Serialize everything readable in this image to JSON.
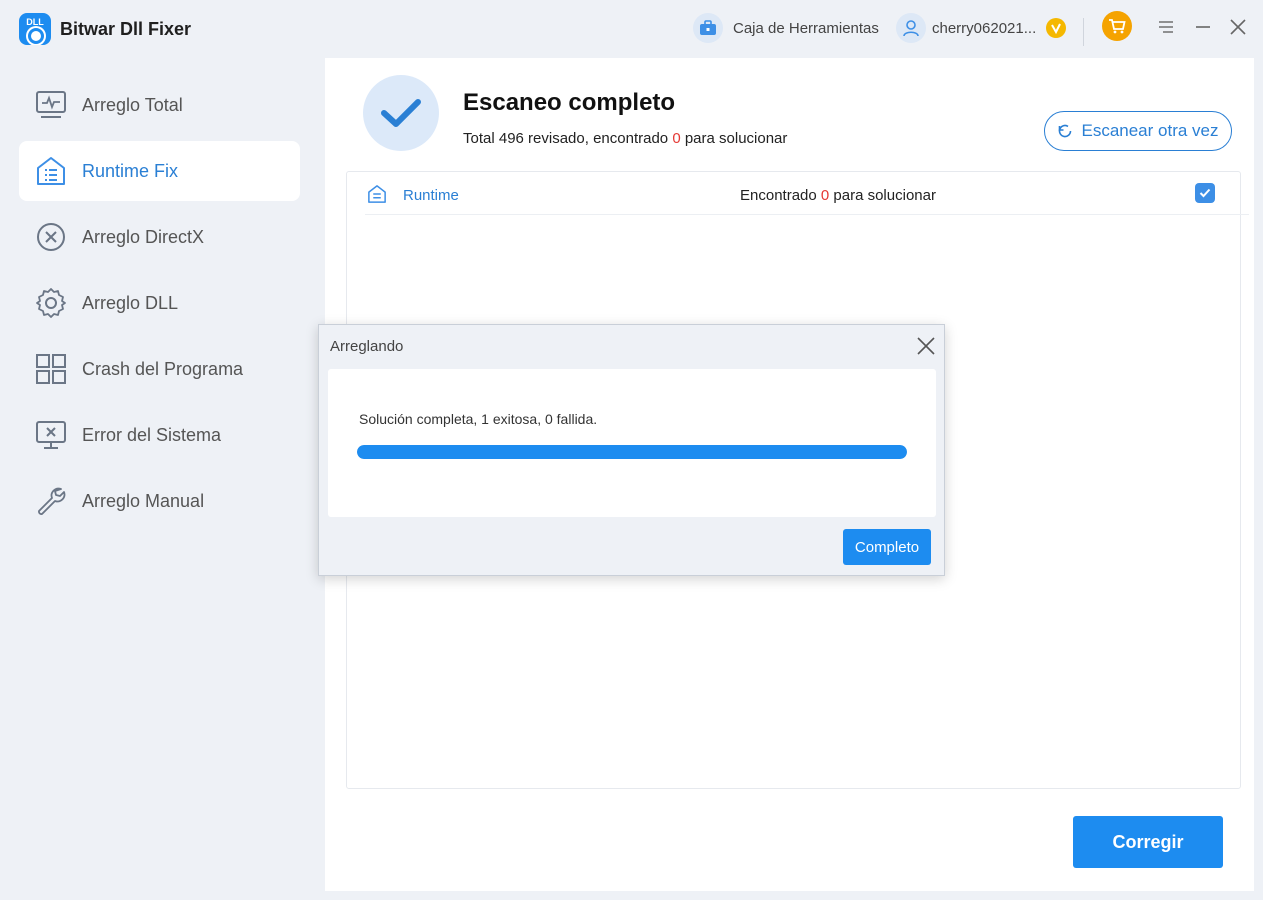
{
  "app": {
    "title": "Bitwar Dll Fixer",
    "logo_text": "DLL"
  },
  "topbar": {
    "toolbox_label": "Caja de Herramientas",
    "username": "cherry062021...",
    "icons": [
      "toolbox-icon",
      "user-icon",
      "vip-badge-icon",
      "cart-icon",
      "menu-icon",
      "minimize-icon",
      "close-icon"
    ]
  },
  "sidebar": {
    "items": [
      {
        "label": "Arreglo Total",
        "icon": "monitor-pulse-icon",
        "active": false
      },
      {
        "label": "Runtime Fix",
        "icon": "runtime-icon",
        "active": true
      },
      {
        "label": "Arreglo DirectX",
        "icon": "x-circle-icon",
        "active": false
      },
      {
        "label": "Arreglo DLL",
        "icon": "gear-icon",
        "active": false
      },
      {
        "label": "Crash del Programa",
        "icon": "grid-icon",
        "active": false
      },
      {
        "label": "Error del Sistema",
        "icon": "monitor-x-icon",
        "active": false
      },
      {
        "label": "Arreglo Manual",
        "icon": "wrench-icon",
        "active": false
      }
    ]
  },
  "main": {
    "scan_title": "Escaneo completo",
    "summary_prefix": "Total 496 revisado, encontrado ",
    "summary_count": "0",
    "summary_suffix": " para solucionar",
    "rescan_label": "Escanear otra vez",
    "results": [
      {
        "name": "Runtime",
        "status_prefix": "Encontrado ",
        "status_count": "0",
        "status_suffix": " para solucionar",
        "checked": true
      }
    ],
    "fix_label": "Corregir"
  },
  "dialog": {
    "title": "Arreglando",
    "message": "Solución completa, 1 exitosa, 0 fallida.",
    "progress_percent": 100,
    "done_label": "Completo"
  },
  "colors": {
    "accent": "#1d8cf0",
    "link": "#2a7fd4",
    "count_red": "#e53935",
    "vip": "#f5b800",
    "cart": "#f5a300"
  }
}
